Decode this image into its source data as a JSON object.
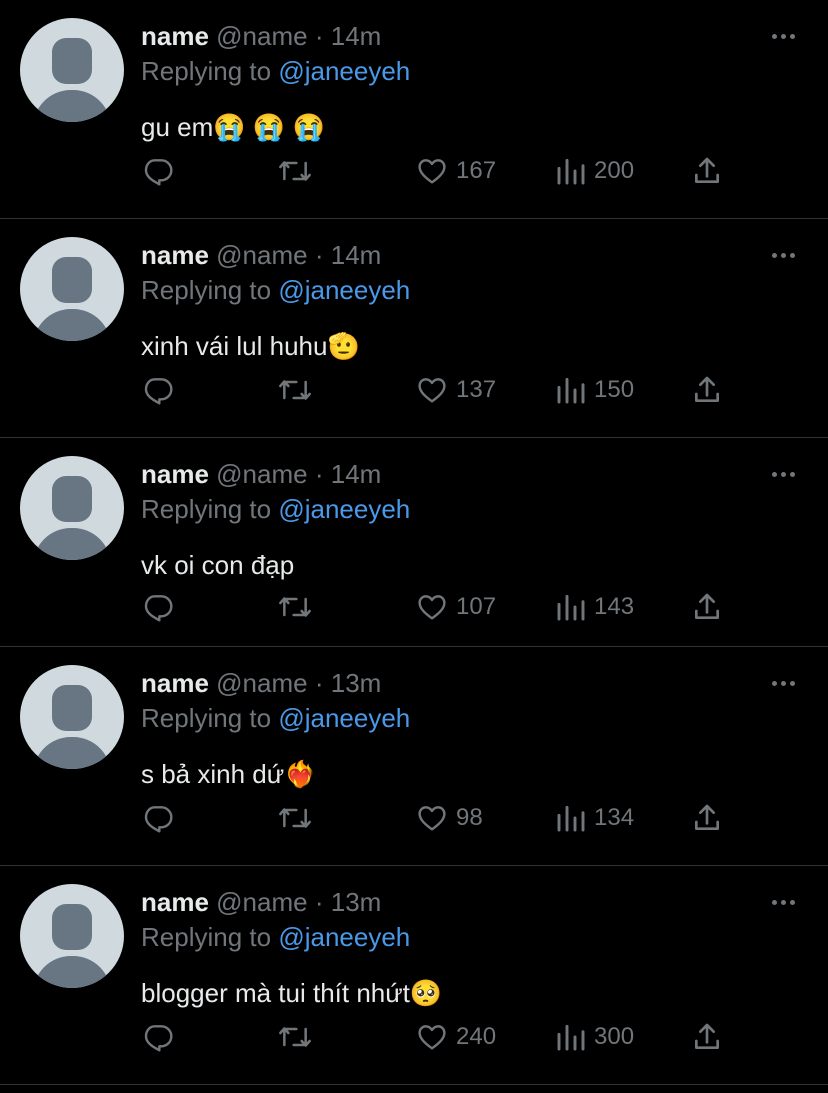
{
  "tweets": [
    {
      "name": "name",
      "handle": "@name",
      "dot": "·",
      "time": "14m",
      "replying_label": "Replying to",
      "replying_to": "@janeeyeh",
      "text": "gu em😭 😭 😭",
      "likes": "167",
      "views": "200"
    },
    {
      "name": "name",
      "handle": "@name",
      "dot": "·",
      "time": "14m",
      "replying_label": "Replying to",
      "replying_to": "@janeeyeh",
      "text": "xinh vái lul huhu🫡",
      "likes": "137",
      "views": "150"
    },
    {
      "name": "name",
      "handle": "@name",
      "dot": "·",
      "time": "14m",
      "replying_label": "Replying to",
      "replying_to": "@janeeyeh",
      "text": "vk oi con đạp",
      "likes": "107",
      "views": "143"
    },
    {
      "name": "name",
      "handle": "@name",
      "dot": "·",
      "time": "13m",
      "replying_label": "Replying to",
      "replying_to": "@janeeyeh",
      "text": "s bả xinh dứ❤️‍🔥",
      "likes": "98",
      "views": "134"
    },
    {
      "name": "name",
      "handle": "@name",
      "dot": "·",
      "time": "13m",
      "replying_label": "Replying to",
      "replying_to": "@janeeyeh",
      "text": "blogger mà tui thít nhứt🥺",
      "likes": "240",
      "views": "300"
    }
  ],
  "icons": {
    "avatar": "default-avatar-icon",
    "more": "more-dots-icon",
    "reply": "reply-icon",
    "retweet": "retweet-icon",
    "like": "heart-icon",
    "views": "views-icon",
    "share": "share-icon"
  },
  "colors": {
    "background": "#000000",
    "text": "#e7e9ea",
    "muted": "#71767b",
    "link": "#4a99e9",
    "divider": "#2f3336"
  }
}
